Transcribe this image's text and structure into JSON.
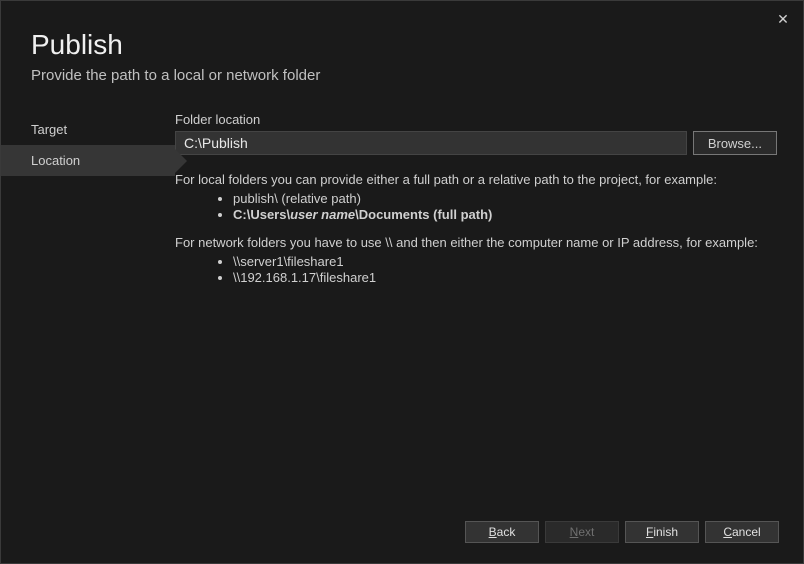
{
  "title": "Publish",
  "subtitle": "Provide the path to a local or network folder",
  "sidebar": {
    "items": [
      {
        "label": "Target",
        "active": false
      },
      {
        "label": "Location",
        "active": true
      }
    ]
  },
  "form": {
    "folder_label": "Folder location",
    "folder_value": "C:\\Publish",
    "browse_label": "Browse..."
  },
  "help": {
    "local_intro": "For local folders you can provide either a full path or a relative path to the project, for example:",
    "local_ex1_pre": "publish\\ (relative path)",
    "local_ex2_prefix": "C:\\Users\\",
    "local_ex2_var": "user name",
    "local_ex2_suffix": "\\Documents (full path)",
    "network_intro": "For network folders you have to use \\\\ and then either the computer name or IP address, for example:",
    "network_ex1": "\\\\server1\\fileshare1",
    "network_ex2": "\\\\192.168.1.17\\fileshare1"
  },
  "footer": {
    "back": "ack",
    "back_mn": "B",
    "next": "ext",
    "next_mn": "N",
    "finish": "inish",
    "finish_mn": "F",
    "cancel": "ancel",
    "cancel_mn": "C"
  }
}
